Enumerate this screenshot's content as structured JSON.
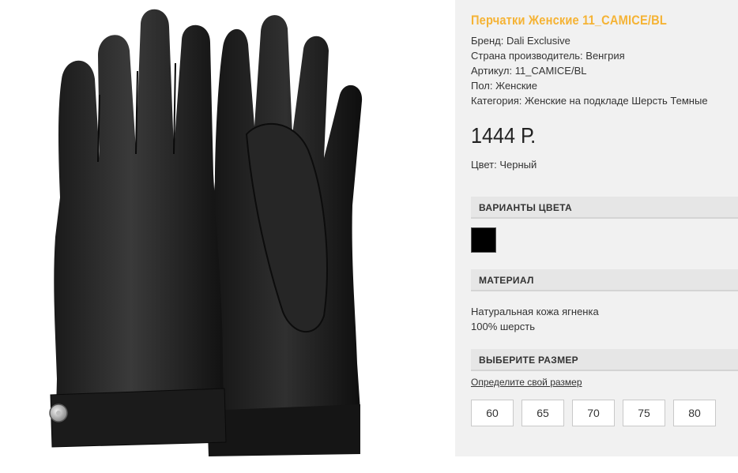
{
  "product": {
    "title": "Перчатки Женские 11_CAMICE/BL",
    "specs": [
      "Бренд: Dali Exclusive",
      "Страна производитель: Венгрия",
      "Артикул: 11_CAMICE/BL",
      "Пол: Женские",
      "Категория: Женские на подкладе Шерсть Темные"
    ],
    "price": "1444 Р.",
    "color_line": "Цвет: Черный",
    "image_icon": "leather-gloves-photo"
  },
  "colors": {
    "heading": "ВАРИАНТЫ ЦВЕТА",
    "swatches": [
      {
        "color": "#000000"
      }
    ]
  },
  "material": {
    "heading": "МАТЕРИАЛ",
    "lines": [
      "Натуральная кожа ягненка",
      "100% шерсть"
    ]
  },
  "size": {
    "heading": "ВЫБЕРИТЕ РАЗМЕР",
    "link": "Определите свой размер",
    "options": [
      "60",
      "65",
      "70",
      "75",
      "80"
    ]
  },
  "theme": {
    "title_color": "#f5b335",
    "panel_bg": "#f1f1f1",
    "bar_bg": "#e6e6e6"
  }
}
